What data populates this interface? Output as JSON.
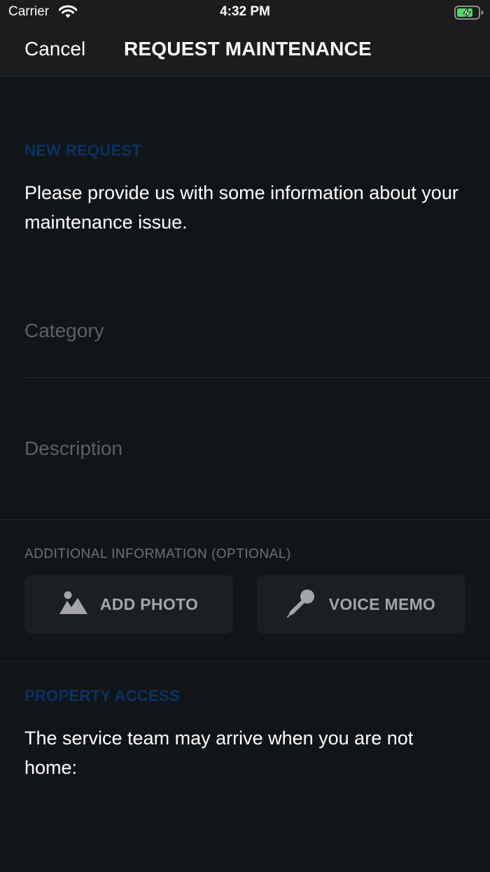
{
  "status_bar": {
    "carrier": "Carrier",
    "time": "4:32 PM"
  },
  "nav": {
    "cancel_label": "Cancel",
    "title": "REQUEST MAINTENANCE"
  },
  "new_request": {
    "header": "NEW REQUEST",
    "intro": "Please provide us with some information about your maintenance issue."
  },
  "form": {
    "category_placeholder": "Category",
    "description_placeholder": "Description"
  },
  "additional": {
    "label": "ADDITIONAL INFORMATION (OPTIONAL)",
    "add_photo_label": "ADD PHOTO",
    "voice_memo_label": "VOICE MEMO",
    "add_photo_icon": "photo-icon",
    "voice_memo_icon": "microphone-icon"
  },
  "property_access": {
    "header": "PROPERTY ACCESS",
    "text": "The service team may arrive when you are not home:"
  },
  "colors": {
    "background": "#121518",
    "bar_background": "#1b1c1d",
    "section_header": "#0a3266",
    "placeholder": "#5c5f63",
    "button_background": "#1c1f22",
    "button_text": "#a3a5a8",
    "battery_green": "#4cd964"
  }
}
